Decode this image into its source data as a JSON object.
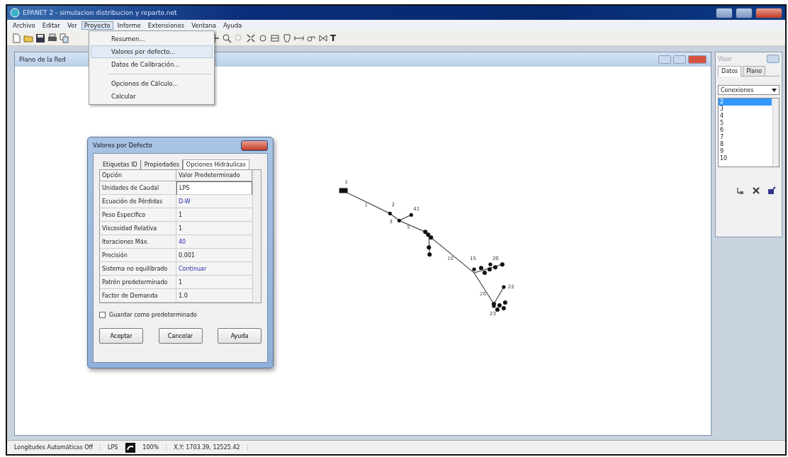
{
  "window": {
    "title": "EPANET 2 - simulacion distribucion y reparto.net"
  },
  "menu": [
    {
      "label": "Archivo",
      "selected": false
    },
    {
      "label": "Editar",
      "selected": false
    },
    {
      "label": "Ver",
      "selected": false
    },
    {
      "label": "Proyecto",
      "selected": true
    },
    {
      "label": "Informe",
      "selected": false
    },
    {
      "label": "Extensiones",
      "selected": false
    },
    {
      "label": "Ventana",
      "selected": false
    },
    {
      "label": "Ayuda",
      "selected": false
    }
  ],
  "dropdown": [
    {
      "kind": "item",
      "label": "Resumen...",
      "selected": false
    },
    {
      "kind": "item",
      "label": "Valores por defecto...",
      "selected": true
    },
    {
      "kind": "item",
      "label": "Datos de Calibración...",
      "selected": false
    },
    {
      "kind": "separator"
    },
    {
      "kind": "item",
      "label": "Opciones de Cálculo...",
      "selected": false
    },
    {
      "kind": "item",
      "label": "Calcular",
      "selected": false
    }
  ],
  "toolbar": {
    "text_tool": "T"
  },
  "map_window": {
    "title": "Plano de la Red",
    "node_labels": [
      "1",
      "2",
      "3",
      "41",
      "15",
      "20",
      "22",
      "23"
    ],
    "link_labels": [
      "1",
      "5",
      "10",
      "20"
    ]
  },
  "dialog": {
    "title": "Valores por Defecto",
    "tabs": [
      {
        "label": "Etiquetas ID",
        "selected": false
      },
      {
        "label": "Propiedades",
        "selected": false
      },
      {
        "label": "Opciones Hidráulicas",
        "selected": true
      }
    ],
    "columns": [
      "Opción",
      "Valor Predeterminado"
    ],
    "rows": [
      {
        "option": "Unidades de Caudal",
        "value": "LPS",
        "kind": "edit"
      },
      {
        "option": "Ecuación de Pérdidas",
        "value": "D-W",
        "kind": "choice"
      },
      {
        "option": "Peso Específico",
        "value": "1",
        "kind": "plain"
      },
      {
        "option": "Viscosidad Relativa",
        "value": "1",
        "kind": "plain"
      },
      {
        "option": "Iteraciones Máx.",
        "value": "40",
        "kind": "choice"
      },
      {
        "option": "Precisión",
        "value": "0.001",
        "kind": "plain"
      },
      {
        "option": "Sistema no equilibrado",
        "value": "Continuar",
        "kind": "choice"
      },
      {
        "option": "Patrón predeterminado",
        "value": "1",
        "kind": "plain"
      },
      {
        "option": "Factor de Demanda",
        "value": "1.0",
        "kind": "plain"
      }
    ],
    "save_default": {
      "label": "Guardar como predeterminado",
      "checked": false
    },
    "buttons": [
      "Aceptar",
      "Cancelar",
      "Ayuda"
    ]
  },
  "browser": {
    "title": "Visor",
    "tabs": [
      {
        "label": "Datos",
        "selected": true
      },
      {
        "label": "Plano",
        "selected": false
      }
    ],
    "category": "Conexiones",
    "items": [
      {
        "label": "2",
        "selected": true
      },
      {
        "label": "3",
        "selected": false
      },
      {
        "label": "4",
        "selected": false
      },
      {
        "label": "5",
        "selected": false
      },
      {
        "label": "6",
        "selected": false
      },
      {
        "label": "7",
        "selected": false
      },
      {
        "label": "8",
        "selected": false
      },
      {
        "label": "9",
        "selected": false
      },
      {
        "label": "10",
        "selected": false
      }
    ]
  },
  "status_bar": {
    "auto_length": "Longitudes Automáticas Off",
    "units": "LPS",
    "zoom": "100%",
    "coordinates": "X,Y: 1703.39, 12525.42"
  }
}
